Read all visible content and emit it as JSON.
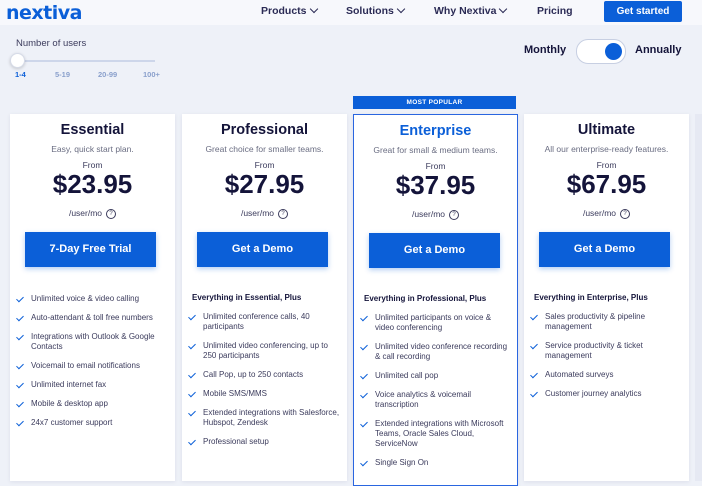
{
  "header": {
    "logo": "nextiva",
    "nav": [
      {
        "label": "Products",
        "has_menu": true
      },
      {
        "label": "Solutions",
        "has_menu": true
      },
      {
        "label": "Why Nextiva",
        "has_menu": true
      },
      {
        "label": "Pricing",
        "has_menu": false
      }
    ],
    "cta_label": "Get started"
  },
  "users_slider": {
    "label": "Number of users",
    "options": [
      "1-4",
      "5-19",
      "20-99",
      "100+"
    ],
    "selected": "1-4"
  },
  "billing_toggle": {
    "monthly_label": "Monthly",
    "annually_label": "Annually",
    "selected": "Annually"
  },
  "popular_badge": "MOST POPULAR",
  "colors": {
    "accent": "#0b5fd8",
    "text": "#14143a",
    "background": "#eef1f8"
  },
  "plans": [
    {
      "name": "Essential",
      "description": "Easy, quick start plan.",
      "from_label": "From",
      "price": "$23.95",
      "per": "/user/mo",
      "cta": "7-Day Free Trial",
      "features_header": "",
      "features": [
        "Unlimited voice & video calling",
        "Auto-attendant & toll free numbers",
        "Integrations with Outlook & Google Contacts",
        "Voicemail to email notifications",
        "Unlimited internet fax",
        "Mobile & desktop app",
        "24x7 customer support"
      ]
    },
    {
      "name": "Professional",
      "description": "Great choice for smaller teams.",
      "from_label": "From",
      "price": "$27.95",
      "per": "/user/mo",
      "cta": "Get a Demo",
      "features_header": "Everything in Essential, Plus",
      "features": [
        "Unlimited conference calls, 40 participants",
        "Unlimited video conferencing, up to 250 participants",
        "Call Pop, up to 250 contacts",
        "Mobile SMS/MMS",
        "Extended integrations with Salesforce, Hubspot, Zendesk",
        "Professional setup"
      ]
    },
    {
      "name": "Enterprise",
      "description": "Great for small & medium teams.",
      "from_label": "From",
      "price": "$37.95",
      "per": "/user/mo",
      "cta": "Get a Demo",
      "features_header": "Everything in Professional, Plus",
      "features": [
        "Unlimited participants on voice & video conferencing",
        "Unlimited video conference recording & call recording",
        "Unlimited call pop",
        "Voice analytics & voicemail transcription",
        "Extended integrations with Microsoft Teams, Oracle Sales Cloud, ServiceNow",
        "Single Sign On"
      ]
    },
    {
      "name": "Ultimate",
      "description": "All our enterprise-ready features.",
      "from_label": "From",
      "price": "$67.95",
      "per": "/user/mo",
      "cta": "Get a Demo",
      "features_header": "Everything in Enterprise, Plus",
      "features": [
        "Sales productivity & pipeline management",
        "Service productivity & ticket management",
        "Automated surveys",
        "Customer journey analytics"
      ]
    }
  ]
}
